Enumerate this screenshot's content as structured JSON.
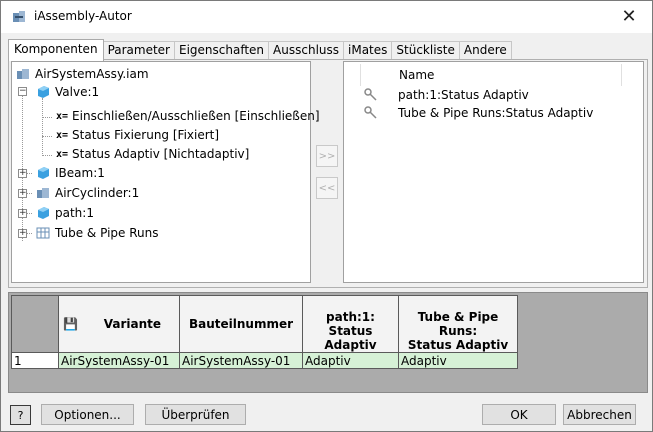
{
  "window": {
    "title": "iAssembly-Autor",
    "close_glyph": "✕"
  },
  "tabs": [
    "Komponenten",
    "Parameter",
    "Eigenschaften",
    "Ausschluss",
    "iMates",
    "Stückliste",
    "Andere"
  ],
  "tree": {
    "root": "AirSystemAssy.iam",
    "valve": "Valve:1",
    "valve_children": [
      "Einschließen/Ausschließen [Einschließen]",
      "Status Fixierung [Fixiert]",
      "Status Adaptiv [Nichtadaptiv]"
    ],
    "ibeam": "IBeam:1",
    "aircyl": "AirCyclinder:1",
    "path": "path:1",
    "tube": "Tube & Pipe Runs",
    "x_glyph": "x="
  },
  "move_buttons": {
    "add": ">>",
    "remove": "<<"
  },
  "list": {
    "header": "Name",
    "items": [
      "path:1:Status Adaptiv",
      "Tube & Pipe Runs:Status Adaptiv"
    ]
  },
  "grid": {
    "headers": [
      "Variante",
      "Bauteilnummer",
      "path:1:\nStatus Adaptiv",
      "Tube & Pipe Runs:\nStatus Adaptiv"
    ],
    "rows": [
      {
        "index": "1",
        "cells": [
          "AirSystemAssy-01",
          "AirSystemAssy-01",
          "Adaptiv",
          "Adaptiv"
        ]
      }
    ]
  },
  "buttons": {
    "help": "?",
    "options": "Optionen...",
    "check": "Überprüfen",
    "ok": "OK",
    "cancel": "Abbrechen"
  },
  "colors": {
    "row_green": "#d6f1d6",
    "cube_blue": "#3aa0e0"
  }
}
